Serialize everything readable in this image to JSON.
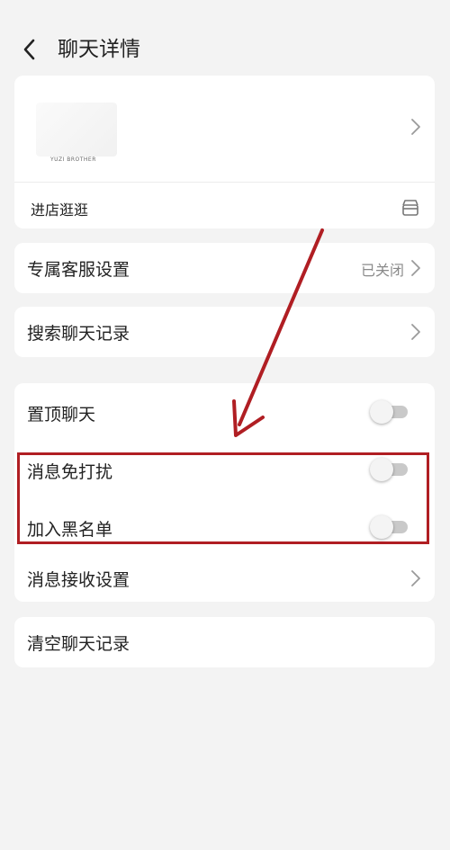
{
  "header": {
    "title": "聊天详情",
    "back_icon": "chevron-left-icon"
  },
  "shop": {
    "logo_text": "YUZI BROTHER",
    "visit_label": "进店逛逛",
    "store_icon": "store-icon"
  },
  "settings": {
    "exclusive_service": {
      "label": "专属客服设置",
      "value": "已关闭"
    },
    "search_history": {
      "label": "搜索聊天记录"
    },
    "pin_chat": {
      "label": "置顶聊天",
      "on": false
    },
    "mute": {
      "label": "消息免打扰",
      "on": false
    },
    "blacklist": {
      "label": "加入黑名单",
      "on": false
    },
    "receive_settings": {
      "label": "消息接收设置"
    },
    "clear_history": {
      "label": "清空聊天记录"
    }
  },
  "colors": {
    "annotation": "#b01e23",
    "card": "#ffffff",
    "background": "#f3f3f3"
  }
}
